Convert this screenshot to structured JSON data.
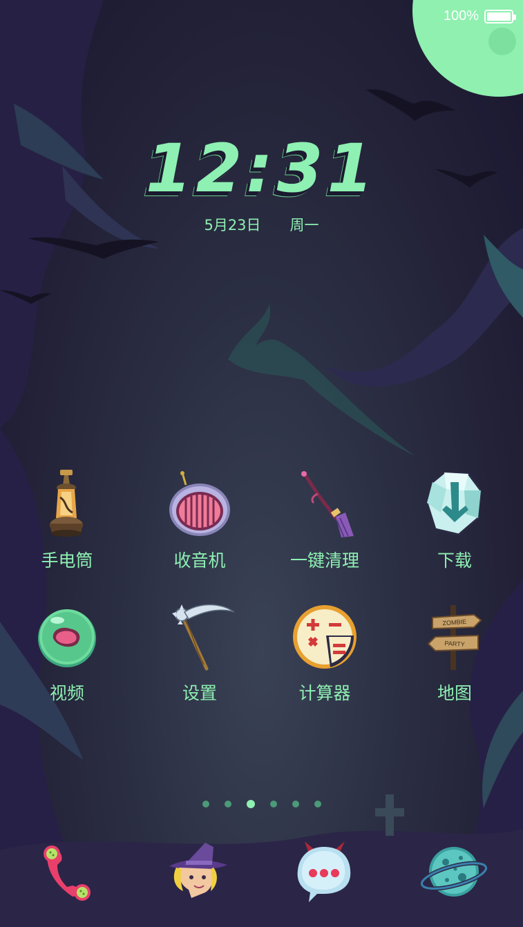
{
  "status": {
    "battery": "100%",
    "battery_level": 1.0
  },
  "clock": {
    "time": "12:31",
    "date": "5月23日",
    "weekday": "周一"
  },
  "apps": [
    {
      "label": "手电筒",
      "icon": "lantern-icon"
    },
    {
      "label": "收音机",
      "icon": "radio-icon"
    },
    {
      "label": "一键清理",
      "icon": "broom-icon"
    },
    {
      "label": "下载",
      "icon": "download-gem-icon"
    },
    {
      "label": "视频",
      "icon": "slime-orb-icon"
    },
    {
      "label": "设置",
      "icon": "scythe-icon"
    },
    {
      "label": "计算器",
      "icon": "calculator-pizza-icon"
    },
    {
      "label": "地图",
      "icon": "signpost-icon"
    }
  ],
  "signpost": {
    "sign1": "ZOMBIE",
    "sign2": "PARTY"
  },
  "pages": {
    "count": 6,
    "active": 3
  },
  "dock": [
    {
      "icon": "phone-icon"
    },
    {
      "icon": "witch-icon"
    },
    {
      "icon": "message-ghost-icon"
    },
    {
      "icon": "planet-icon"
    }
  ],
  "colors": {
    "accent": "#8ef0b2",
    "background": "#232238",
    "moon": "#8ff0b0"
  }
}
